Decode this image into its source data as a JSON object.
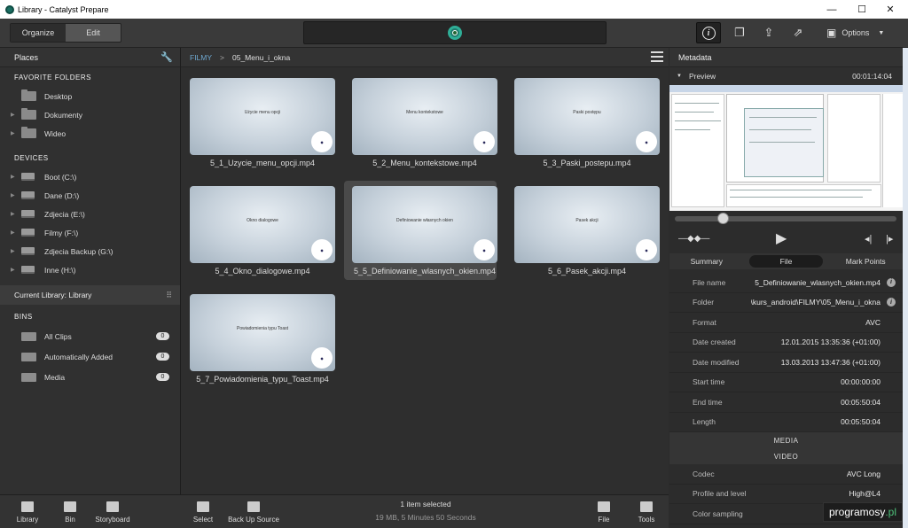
{
  "window": {
    "title": "Library - Catalyst Prepare",
    "minimize": "—",
    "maximize": "☐",
    "close": "✕"
  },
  "toolbar": {
    "organize": "Organize",
    "edit": "Edit",
    "options": "Options"
  },
  "places": {
    "title": "Places",
    "favorites_title": "FAVORITE FOLDERS",
    "favorites": [
      "Desktop",
      "Dokumenty",
      "Wideo"
    ],
    "devices_title": "DEVICES",
    "devices": [
      "Boot (C:\\)",
      "Dane (D:\\)",
      "Zdjecia (E:\\)",
      "Filmy (F:\\)",
      "Zdjecia Backup (G:\\)",
      "Inne (H:\\)"
    ]
  },
  "library": {
    "current": "Current Library: Library",
    "bins_title": "BINS",
    "bins": [
      {
        "label": "All Clips",
        "count": "0"
      },
      {
        "label": "Automatically Added",
        "count": "0"
      },
      {
        "label": "Media",
        "count": "0"
      }
    ]
  },
  "breadcrumb": {
    "root": "FILMY",
    "sep": ">",
    "current": "05_Menu_i_okna"
  },
  "clips": [
    {
      "name": "5_1_Uzycie_menu_opcji.mp4",
      "thumb": "Użycie menu opcji"
    },
    {
      "name": "5_2_Menu_kontekstowe.mp4",
      "thumb": "Menu kontekstowe"
    },
    {
      "name": "5_3_Paski_postepu.mp4",
      "thumb": "Paski postępu"
    },
    {
      "name": "5_4_Okno_dialogowe.mp4",
      "thumb": "Okno dialogowe"
    },
    {
      "name": "5_5_Definiowanie_wlasnych_okien.mp4",
      "thumb": "Definiowanie własnych okien"
    },
    {
      "name": "5_6_Pasek_akcji.mp4",
      "thumb": "Pasek akcji"
    },
    {
      "name": "5_7_Powiadomienia_typu_Toast.mp4",
      "thumb": "Powiadomienia typu Toast"
    }
  ],
  "bottom": {
    "library": "Library",
    "bin": "Bin",
    "storyboard": "Storyboard",
    "select": "Select",
    "backup": "Back Up Source",
    "file": "File",
    "tools": "Tools",
    "status1": "1 item selected",
    "status2": "19 MB, 5 Minutes 50 Seconds"
  },
  "metadata": {
    "title": "Metadata",
    "preview_label": "Preview",
    "preview_time": "00:01:14:04",
    "tabs": [
      "Summary",
      "File",
      "Mark Points"
    ],
    "rows": [
      {
        "k": "File name",
        "v": "5_Definiowanie_wlasnych_okien.mp4"
      },
      {
        "k": "Folder",
        "v": "\\kurs_android\\FILMY\\05_Menu_i_okna"
      },
      {
        "k": "Format",
        "v": "AVC"
      },
      {
        "k": "Date created",
        "v": "12.01.2015 13:35:36 (+01:00)"
      },
      {
        "k": "Date modified",
        "v": "13.03.2013 13:47:36 (+01:00)"
      },
      {
        "k": "Start time",
        "v": "00:00:00:00"
      },
      {
        "k": "End time",
        "v": "00:05:50:04"
      },
      {
        "k": "Length",
        "v": "00:05:50:04"
      }
    ],
    "media_title": "MEDIA",
    "video_title": "VIDEO",
    "video_rows": [
      {
        "k": "Codec",
        "v": "AVC Long"
      },
      {
        "k": "Profile and level",
        "v": "High@L4"
      },
      {
        "k": "Color sampling",
        "v": ""
      }
    ]
  },
  "watermark": {
    "a": "programosy",
    "b": ".pl"
  }
}
